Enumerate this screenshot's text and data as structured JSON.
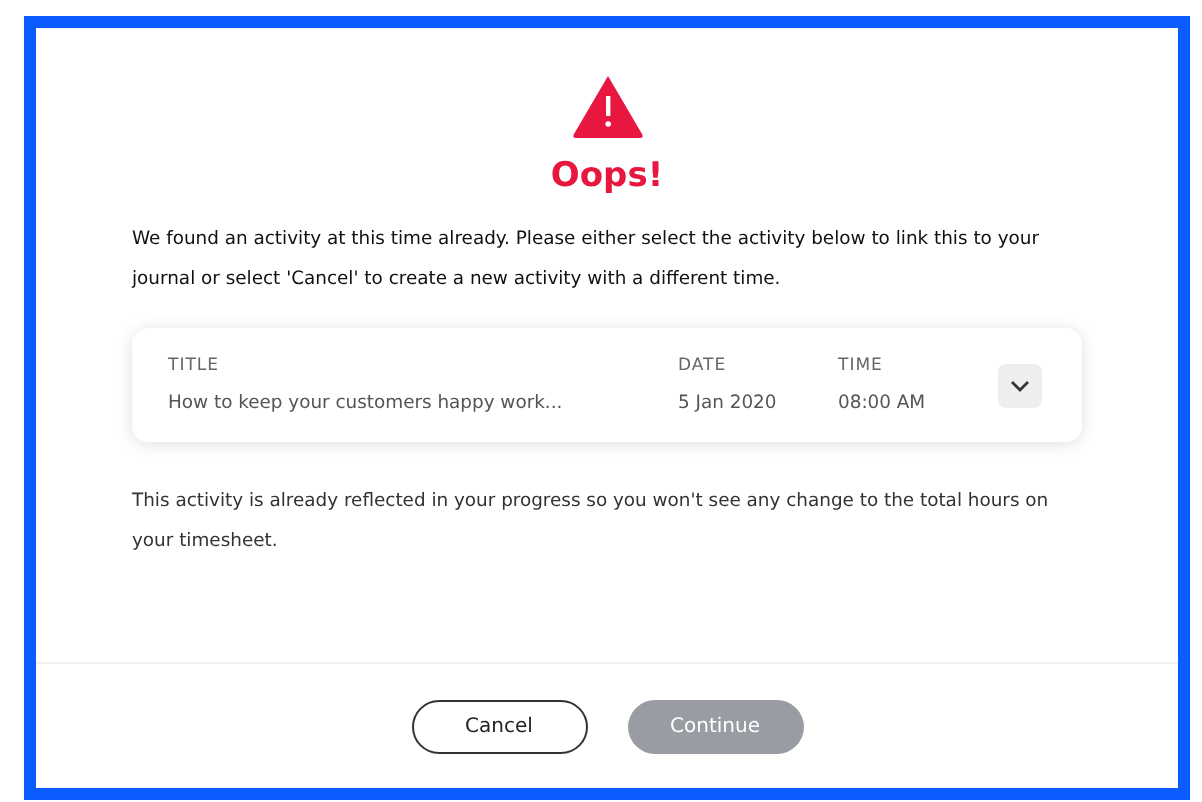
{
  "dialog": {
    "title": "Oops!",
    "message": "We found an activity at this time already. Please either select the activity below to link this to your journal or select 'Cancel' to create a new activity with a different time.",
    "activity": {
      "columns": [
        "TITLE",
        "DATE",
        "TIME"
      ],
      "values": [
        "How to keep your customers happy work...",
        "5 Jan 2020",
        "08:00 AM"
      ],
      "expanded": false
    },
    "note": "This activity is already reflected in your progress so you won't see any change to the total hours on your timesheet.",
    "buttons": [
      {
        "label": "Cancel",
        "kind": "secondary",
        "disabled": false
      },
      {
        "label": "Continue",
        "kind": "primary",
        "disabled": true
      }
    ]
  }
}
